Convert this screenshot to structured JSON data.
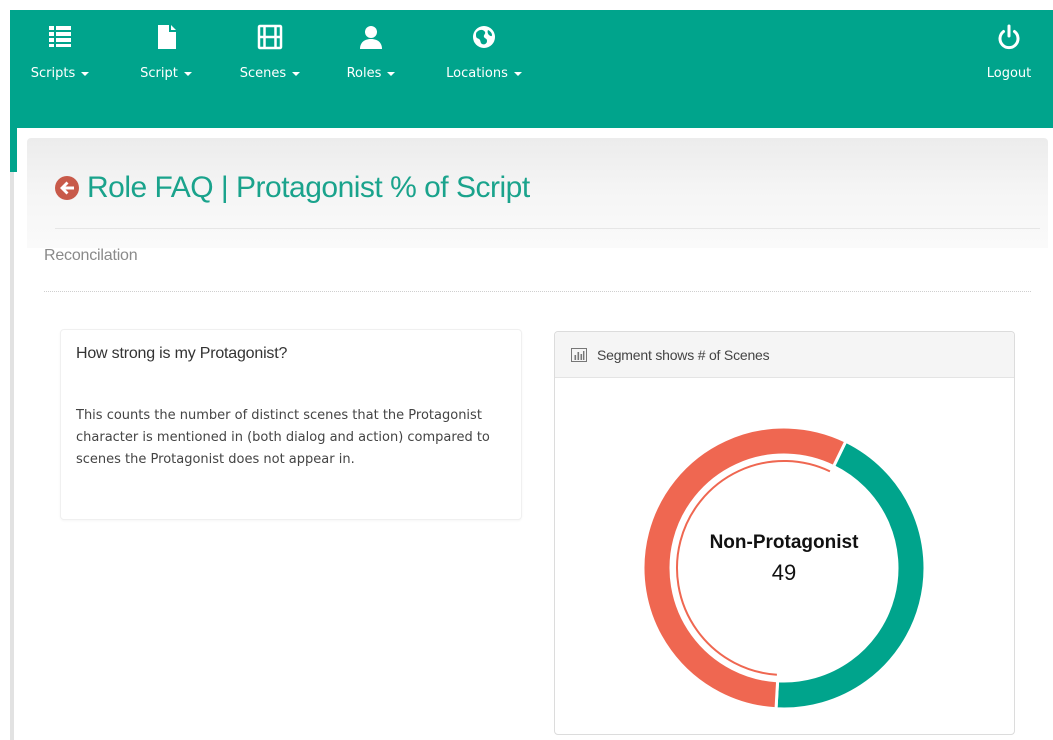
{
  "nav": {
    "items": [
      {
        "label": "Scripts",
        "icon": "list-icon"
      },
      {
        "label": "Script",
        "icon": "file-icon"
      },
      {
        "label": "Scenes",
        "icon": "film-icon"
      },
      {
        "label": "Roles",
        "icon": "user-icon"
      },
      {
        "label": "Locations",
        "icon": "globe-icon"
      }
    ],
    "logout": {
      "label": "Logout",
      "icon": "power-icon"
    }
  },
  "page": {
    "title": "Role FAQ | Protagonist % of Script",
    "subtitle": "Reconcilation"
  },
  "faq": {
    "title": "How strong is my Protagonist?",
    "body": "This counts the number of distinct scenes that the Protagonist character is mentioned in (both dialog and action) compared to scenes the Protagonist does not appear in."
  },
  "chart_panel": {
    "title": "Segment shows # of Scenes",
    "icon": "bar-chart-icon"
  },
  "chart_data": {
    "type": "pie",
    "donut": true,
    "series": [
      {
        "name": "Protagonist",
        "value": 38,
        "color": "#00a48c"
      },
      {
        "name": "Non-Protagonist",
        "value": 49,
        "color": "#ef6751",
        "highlighted": true
      }
    ],
    "center_label": "Non-Protagonist",
    "center_value": "49"
  },
  "colors": {
    "brand": "#00a48c",
    "accent": "#ef6751",
    "title": "#1aa38c"
  }
}
